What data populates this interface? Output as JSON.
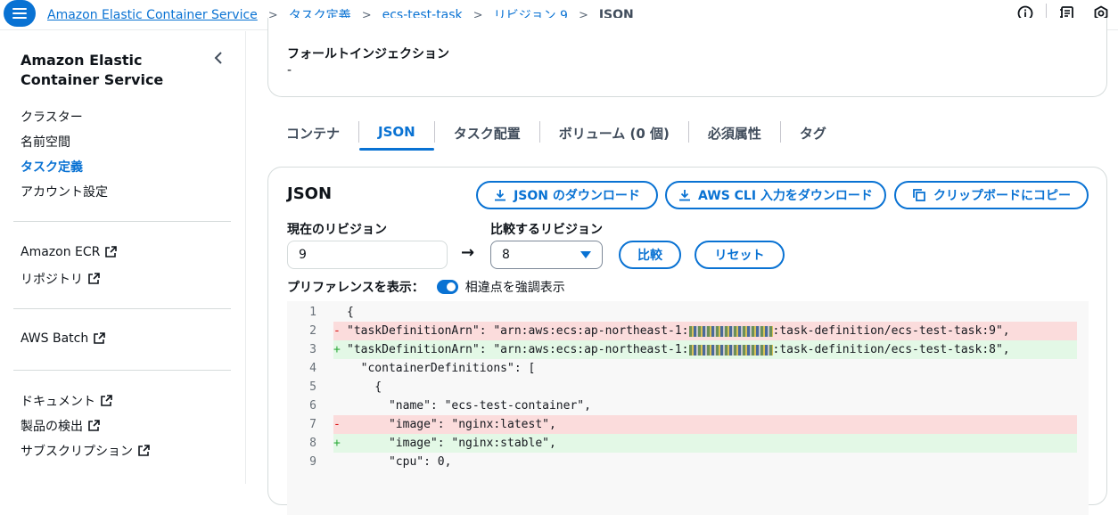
{
  "topbar": {
    "breadcrumb": [
      "Amazon Elastic Container Service",
      "タスク定義",
      "ecs-test-task",
      "リビジョン 9"
    ],
    "current": "JSON"
  },
  "sidebar": {
    "title": "Amazon Elastic Container Service",
    "group1": [
      "クラスター",
      "名前空間",
      "タスク定義",
      "アカウント設定"
    ],
    "group2": [
      "Amazon ECR",
      "リポジトリ"
    ],
    "group3": [
      "AWS Batch"
    ],
    "group4": [
      "ドキュメント",
      "製品の検出",
      "サブスクリプション"
    ]
  },
  "fault": {
    "label": "フォールトインジェクション",
    "value": "-"
  },
  "tabs": [
    "コンテナ",
    "JSON",
    "タスク配置",
    "ボリューム (0 個)",
    "必須属性",
    "タグ"
  ],
  "json_panel": {
    "title": "JSON",
    "download_json": "JSON のダウンロード",
    "download_cli": "AWS CLI 入力をダウンロード",
    "copy": "クリップボードにコピー",
    "current_label": "現在のリビジョン",
    "current_value": "9",
    "compare_label": "比較するリビジョン",
    "compare_value": "8",
    "compare_button": "比較",
    "reset_button": "リセット",
    "pref_label": "プリファレンスを表示：",
    "toggle_label": "相違点を強調表示"
  },
  "code_lines": [
    {
      "n": "1",
      "mark": "",
      "text": "{"
    },
    {
      "n": "2",
      "mark": "-",
      "text": "\"taskDefinitionArn\": \"arn:aws:ecs:ap-northeast-1:"
    },
    {
      "n": "3",
      "mark": "+",
      "text": "\"taskDefinitionArn\": \"arn:aws:ecs:ap-northeast-1:"
    },
    {
      "n": "4",
      "mark": "",
      "text": "  \"containerDefinitions\": ["
    },
    {
      "n": "5",
      "mark": "",
      "text": "    {"
    },
    {
      "n": "6",
      "mark": "",
      "text": "      \"name\": \"ecs-test-container\","
    },
    {
      "n": "7",
      "mark": "-",
      "text": "      \"image\": \"nginx:latest\","
    },
    {
      "n": "8",
      "mark": "+",
      "text": "      \"image\": \"nginx:stable\","
    },
    {
      "n": "9",
      "mark": "",
      "text": "      \"cpu\": 0,"
    }
  ],
  "code_suffix": {
    "line2": ":task-definition/ecs-test-task:9\",",
    "line3": ":task-definition/ecs-test-task:8\","
  },
  "colors": {
    "accent": "#0972d3",
    "del_bg": "#fbdcdc",
    "add_bg": "#e3f8e6"
  }
}
